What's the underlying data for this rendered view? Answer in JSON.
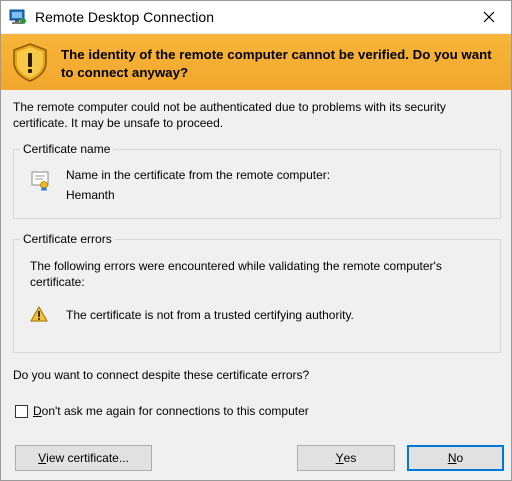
{
  "window": {
    "title": "Remote Desktop Connection",
    "icons": {
      "app": "remote-desktop-icon",
      "close": "close-icon"
    }
  },
  "banner": {
    "icon": "shield-warning-icon",
    "message": "The identity of the remote computer cannot be verified. Do you want to connect anyway?",
    "color": "#f4ad34"
  },
  "intro": "The remote computer could not be authenticated due to problems with its security certificate. It may be unsafe to proceed.",
  "certificate_name": {
    "legend": "Certificate name",
    "icon": "certificate-icon",
    "line1": "Name in the certificate from the remote computer:",
    "line2": "Hemanth"
  },
  "certificate_errors": {
    "legend": "Certificate errors",
    "intro": "The following errors were encountered while validating the remote computer's certificate:",
    "icon": "warning-icon",
    "items": [
      "The certificate is not from a trusted certifying authority."
    ]
  },
  "question": "Do you want to connect despite these certificate errors?",
  "dont_ask": {
    "checked": false,
    "mnemonic": "D",
    "label_rest": "on't ask me again for connections to this computer"
  },
  "buttons": {
    "view": {
      "mnemonic": "V",
      "rest": "iew certificate..."
    },
    "yes": {
      "mnemonic": "Y",
      "rest": "es"
    },
    "no": {
      "mnemonic": "N",
      "rest": "o"
    }
  }
}
